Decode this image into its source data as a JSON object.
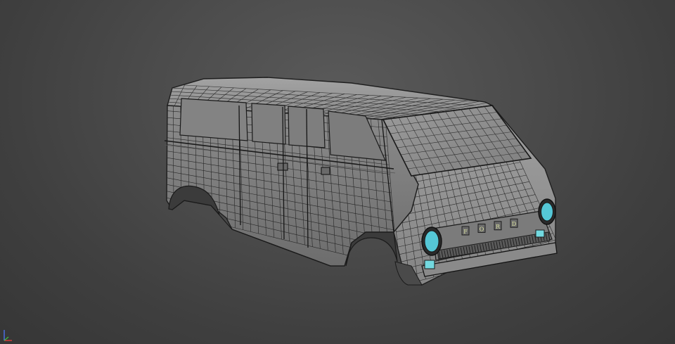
{
  "viewport": {
    "background_center": "#5a5a5a",
    "background_edge": "#363636"
  },
  "model": {
    "body_top_color": "#8f8f8f",
    "body_side_color": "#7a7a7a",
    "body_front_color": "#909090",
    "wire_color": "#1e1e1e",
    "headlight_color": "#55c7d6",
    "indicator_color": "#73d9e0"
  },
  "grille": {
    "badge_letters": [
      "F",
      "O",
      "R",
      "D"
    ]
  },
  "gizmo": {
    "x_color": "#d33a3a",
    "y_color": "#3fbf3f",
    "z_color": "#4a6fe0"
  }
}
